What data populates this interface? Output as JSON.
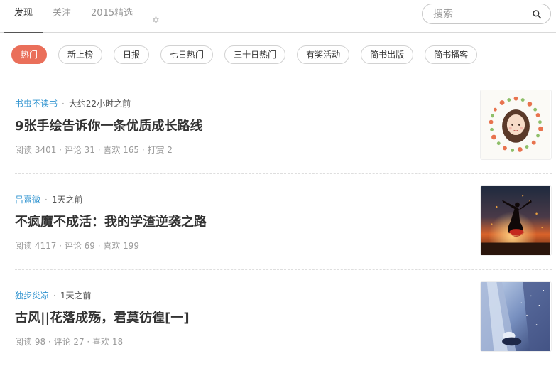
{
  "nav": {
    "tabs": [
      {
        "label": "发现",
        "active": true
      },
      {
        "label": "关注",
        "active": false
      },
      {
        "label": "2015精选",
        "active": false
      }
    ],
    "settings_icon": "gear-icon"
  },
  "search": {
    "placeholder": "搜索",
    "icon": "search-icon"
  },
  "categories": [
    {
      "label": "热门",
      "active": true
    },
    {
      "label": "新上榜",
      "active": false
    },
    {
      "label": "日报",
      "active": false
    },
    {
      "label": "七日热门",
      "active": false
    },
    {
      "label": "三十日热门",
      "active": false
    },
    {
      "label": "有奖活动",
      "active": false
    },
    {
      "label": "简书出版",
      "active": false
    },
    {
      "label": "简书播客",
      "active": false
    }
  ],
  "articles": [
    {
      "author": "书虫不读书",
      "separator": "·",
      "time": "大约22小时之前",
      "title": "9张手绘告诉你一条优质成长路线",
      "stats": "阅读 3401 · 评论 31 · 喜欢 165 · 打赏 2",
      "thumbnail": "girl-flower-wreath-illustration"
    },
    {
      "author": "吕熹微",
      "separator": "·",
      "time": "1天之前",
      "title": "不疯魔不成活：我的学渣逆袭之路",
      "stats": "阅读 4117 · 评论 69 · 喜欢 199",
      "thumbnail": "dancer-silhouette-sunset"
    },
    {
      "author": "独步炎凉",
      "separator": "·",
      "time": "1天之前",
      "title": "古风||花落成殇，君莫彷徨[一]",
      "stats": "阅读 98 · 评论 27 · 喜欢 18",
      "thumbnail": "blue-sky-buildings"
    }
  ],
  "colors": {
    "accent": "#ea6f5a",
    "author_link": "#3194d0",
    "muted": "#999999"
  }
}
